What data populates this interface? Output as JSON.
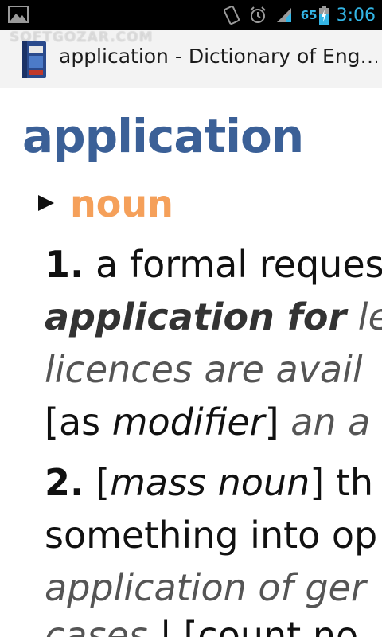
{
  "status_bar": {
    "battery": "65",
    "time": "3:06"
  },
  "action_bar": {
    "title": "application - Dictionary of Eng…",
    "watermark": "SOFTGOZAR.COM"
  },
  "entry": {
    "headword": "application",
    "part_of_speech": "noun",
    "sense1": {
      "number": "1.",
      "line1": "a formal reques",
      "line2_bold": "application for",
      "line2_ex": "le",
      "line3_ex": "licences are avail",
      "line4_open": "[as ",
      "line4_it": "modifier",
      "line4_close": "]",
      "line4_ex": "an a"
    },
    "sense2": {
      "number": "2.",
      "line1_open": "[",
      "line1_it": "mass noun",
      "line1_close": "]",
      "line1_rest": "th",
      "line2": "something into op",
      "line3_ex": "application of ger",
      "line4_ex": "cases",
      "line4_sep": "|",
      "line4_bracket": "[count no"
    }
  },
  "colors": {
    "headword": "#3b6097",
    "part_of_speech": "#f5a05a",
    "status_accent": "#33b5e5"
  }
}
